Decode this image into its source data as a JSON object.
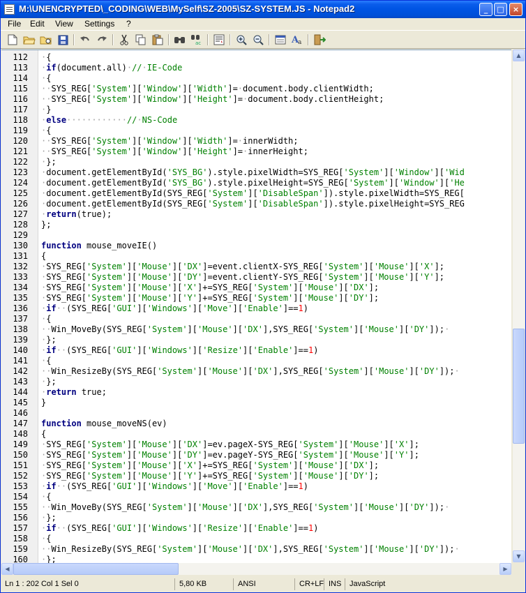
{
  "window": {
    "title": "M:\\UNENCRYPTED\\_CODING\\WEB\\MySelf\\SZ-2005\\SZ-SYSTEM.JS - Notepad2",
    "minimize_label": "_",
    "maximize_label": "□",
    "close_label": "×"
  },
  "menu": {
    "items": [
      "File",
      "Edit",
      "View",
      "Settings",
      "?"
    ]
  },
  "toolbar": {
    "buttons": [
      "new-file-icon",
      "open-folder-icon",
      "browse-icon",
      "save-icon",
      "undo-icon",
      "redo-icon",
      "cut-icon",
      "copy-icon",
      "paste-icon",
      "find-icon",
      "replace-icon",
      "word-wrap-icon",
      "zoom-in-icon",
      "zoom-out-icon",
      "scheme-icon",
      "font-icon",
      "exit-icon"
    ]
  },
  "editor": {
    "lines": [
      {
        "n": "112",
        "t": "·{"
      },
      {
        "n": "113",
        "t": "·if(document.all)·//·IE-Code"
      },
      {
        "n": "114",
        "t": "·{"
      },
      {
        "n": "115",
        "t": "··SYS_REG['System']['Window']['Width']=·document.body.clientWidth;"
      },
      {
        "n": "116",
        "t": "··SYS_REG['System']['Window']['Height']=·document.body.clientHeight;"
      },
      {
        "n": "117",
        "t": "·}"
      },
      {
        "n": "118",
        "t": "·else············//·NS-Code"
      },
      {
        "n": "119",
        "t": "·{"
      },
      {
        "n": "120",
        "t": "··SYS_REG['System']['Window']['Width']=·innerWidth;"
      },
      {
        "n": "121",
        "t": "··SYS_REG['System']['Window']['Height']=·innerHeight;"
      },
      {
        "n": "122",
        "t": "·};"
      },
      {
        "n": "123",
        "t": "·document.getElementById('SYS_BG').style.pixelWidth=SYS_REG['System']['Window']['Wid"
      },
      {
        "n": "124",
        "t": "·document.getElementById('SYS_BG').style.pixelHeight=SYS_REG['System']['Window']['He"
      },
      {
        "n": "125",
        "t": "·document.getElementById(SYS_REG['System']['DisableSpan']).style.pixelWidth=SYS_REG["
      },
      {
        "n": "126",
        "t": "·document.getElementById(SYS_REG['System']['DisableSpan']).style.pixelHeight=SYS_REG"
      },
      {
        "n": "127",
        "t": "·return(true);"
      },
      {
        "n": "128",
        "t": "};"
      },
      {
        "n": "129",
        "t": ""
      },
      {
        "n": "130",
        "t": "function mouse_moveIE()"
      },
      {
        "n": "131",
        "t": "{"
      },
      {
        "n": "132",
        "t": "·SYS_REG['System']['Mouse']['DX']=event.clientX-SYS_REG['System']['Mouse']['X'];"
      },
      {
        "n": "133",
        "t": "·SYS_REG['System']['Mouse']['DY']=event.clientY-SYS_REG['System']['Mouse']['Y'];"
      },
      {
        "n": "134",
        "t": "·SYS_REG['System']['Mouse']['X']+=SYS_REG['System']['Mouse']['DX'];"
      },
      {
        "n": "135",
        "t": "·SYS_REG['System']['Mouse']['Y']+=SYS_REG['System']['Mouse']['DY'];"
      },
      {
        "n": "136",
        "t": "·if··(SYS_REG['GUI']['Windows']['Move']['Enable']==1)"
      },
      {
        "n": "137",
        "t": "·{"
      },
      {
        "n": "138",
        "t": "··Win_MoveBy(SYS_REG['System']['Mouse']['DX'],SYS_REG['System']['Mouse']['DY']);·"
      },
      {
        "n": "139",
        "t": "·};"
      },
      {
        "n": "140",
        "t": "·if··(SYS_REG['GUI']['Windows']['Resize']['Enable']==1)"
      },
      {
        "n": "141",
        "t": "·{"
      },
      {
        "n": "142",
        "t": "··Win_ResizeBy(SYS_REG['System']['Mouse']['DX'],SYS_REG['System']['Mouse']['DY']);·"
      },
      {
        "n": "143",
        "t": "·};"
      },
      {
        "n": "144",
        "t": "·return true;"
      },
      {
        "n": "145",
        "t": "}"
      },
      {
        "n": "146",
        "t": ""
      },
      {
        "n": "147",
        "t": "function mouse_moveNS(ev)"
      },
      {
        "n": "148",
        "t": "{"
      },
      {
        "n": "149",
        "t": "·SYS_REG['System']['Mouse']['DX']=ev.pageX-SYS_REG['System']['Mouse']['X'];"
      },
      {
        "n": "150",
        "t": "·SYS_REG['System']['Mouse']['DY']=ev.pageY-SYS_REG['System']['Mouse']['Y'];"
      },
      {
        "n": "151",
        "t": "·SYS_REG['System']['Mouse']['X']+=SYS_REG['System']['Mouse']['DX'];"
      },
      {
        "n": "152",
        "t": "·SYS_REG['System']['Mouse']['Y']+=SYS_REG['System']['Mouse']['DY'];"
      },
      {
        "n": "153",
        "t": "·if··(SYS_REG['GUI']['Windows']['Move']['Enable']==1)"
      },
      {
        "n": "154",
        "t": "·{"
      },
      {
        "n": "155",
        "t": "··Win_MoveBy(SYS_REG['System']['Mouse']['DX'],SYS_REG['System']['Mouse']['DY']);·"
      },
      {
        "n": "156",
        "t": "·};"
      },
      {
        "n": "157",
        "t": "·if··(SYS_REG['GUI']['Windows']['Resize']['Enable']==1)"
      },
      {
        "n": "158",
        "t": "·{"
      },
      {
        "n": "159",
        "t": "··Win_ResizeBy(SYS_REG['System']['Mouse']['DX'],SYS_REG['System']['Mouse']['DY']);·"
      },
      {
        "n": "160",
        "t": "·};"
      }
    ]
  },
  "statusbar": {
    "position": "Ln 1 : 202   Col 1   Sel 0",
    "size": "5,80 KB",
    "encoding": "ANSI",
    "eol": "CR+LF",
    "mode": "INS",
    "lexer": "JavaScript"
  },
  "colors": {
    "keyword": "#000080",
    "string": "#008000",
    "comment": "#008000",
    "number": "#FF0000",
    "whitespace_dot": "#A0A0A0",
    "title_bar": "#0054E3"
  }
}
